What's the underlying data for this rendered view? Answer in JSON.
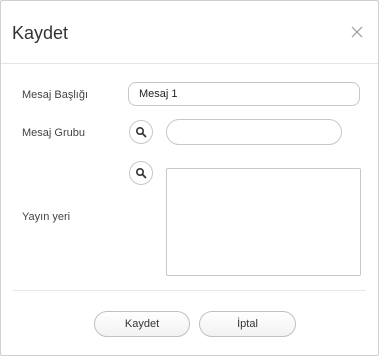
{
  "dialog": {
    "title": "Kaydet",
    "close_icon": "close-icon"
  },
  "form": {
    "message_title": {
      "label": "Mesaj Başlığı",
      "value": "Mesaj 1"
    },
    "message_group": {
      "label": "Mesaj Grubu",
      "value": "",
      "search_icon": "search-icon"
    },
    "publish_location": {
      "label": "Yayın yeri",
      "value": "",
      "search_icon": "search-icon"
    }
  },
  "footer": {
    "save_label": "Kaydet",
    "cancel_label": "İptal"
  },
  "colors": {
    "border": "#c8c8c8",
    "text": "#333333",
    "background": "#ffffff"
  }
}
